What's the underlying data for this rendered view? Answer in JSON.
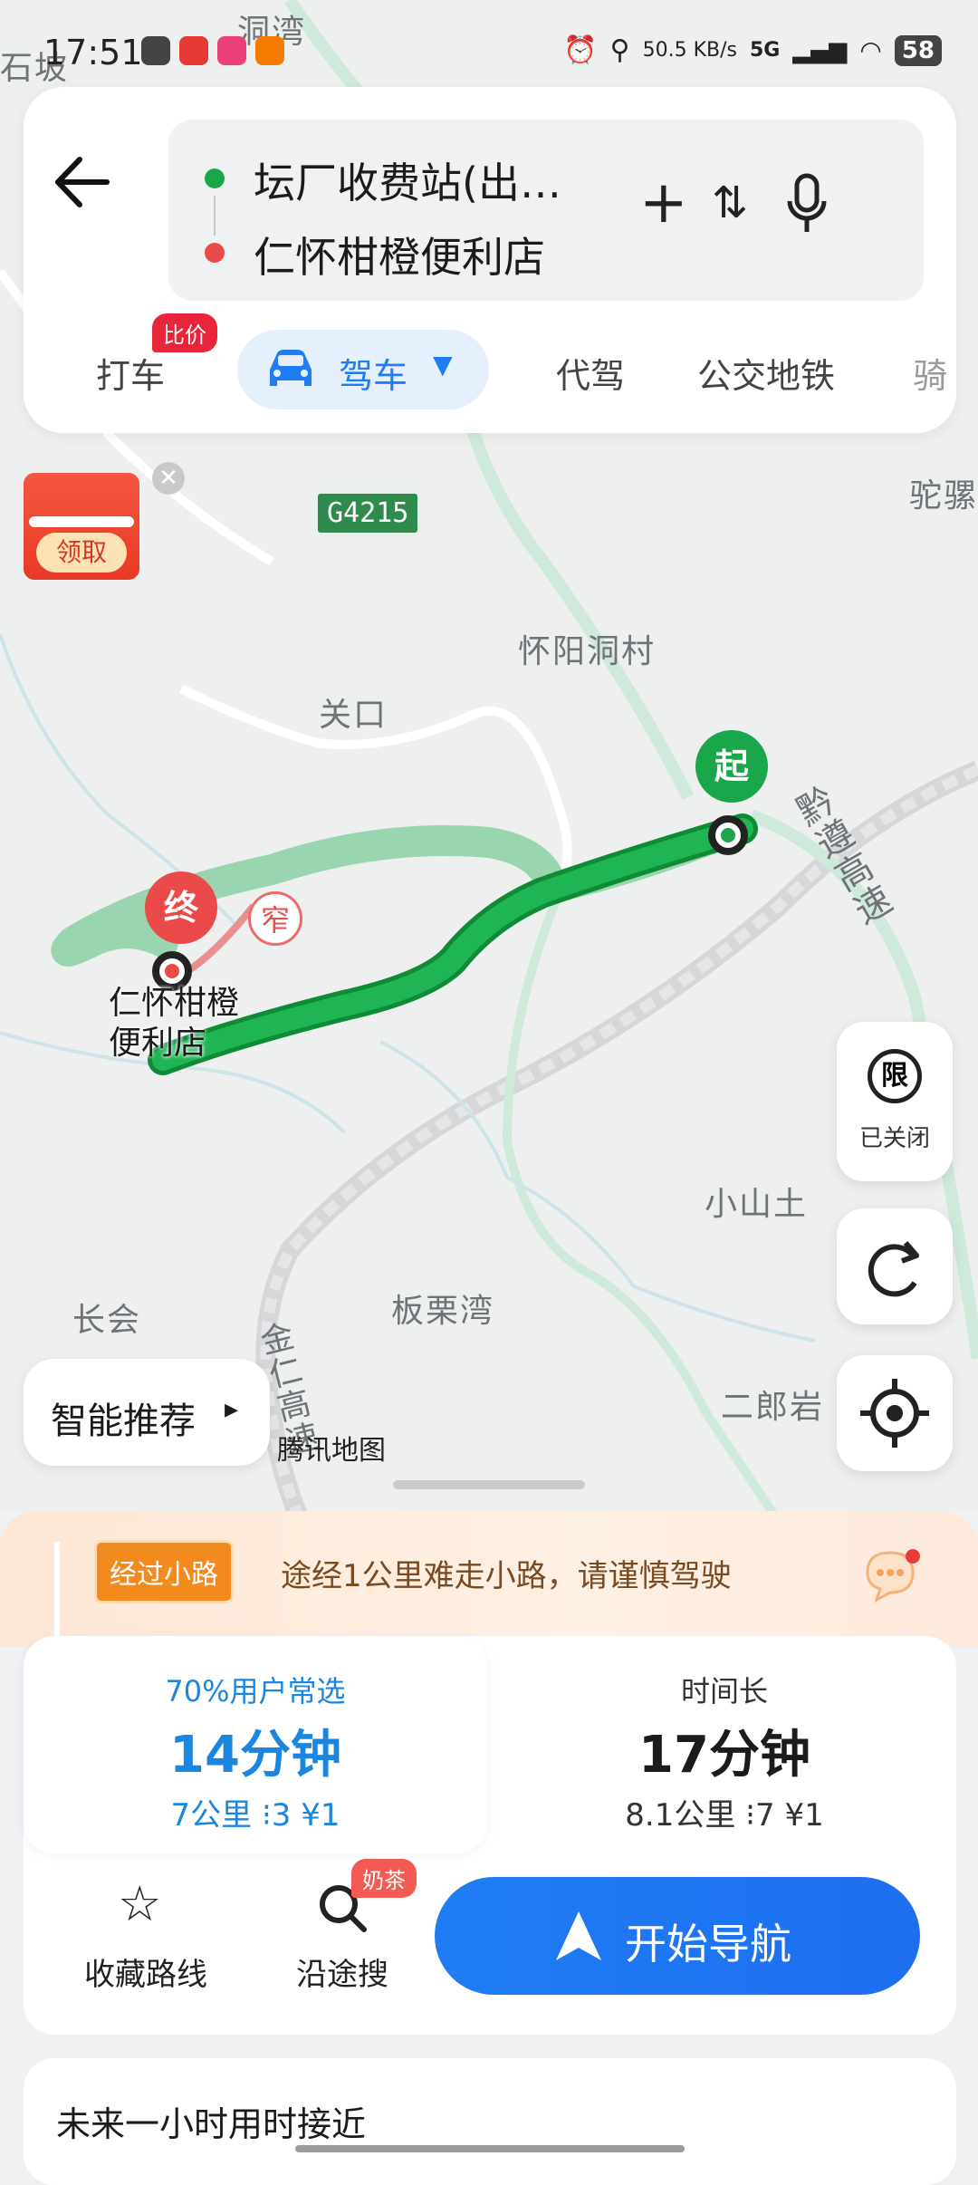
{
  "status": {
    "time": "17:51",
    "speed": "50.5 KB/s",
    "network": "5G",
    "battery": "58"
  },
  "header": {
    "origin": "坛厂收费站(出…",
    "destination": "仁怀柑橙便利店",
    "tabs": {
      "taxi": "打车",
      "taxi_badge": "比价",
      "drive": "驾车",
      "designated": "代驾",
      "transit": "公交地铁",
      "ride": "骑"
    }
  },
  "map": {
    "labels": {
      "dongwan": "洞湾",
      "shipo": "石坡",
      "tuo": "驼骡",
      "g4215": "G4215",
      "huaiyang": "怀阳洞村",
      "guankou": "关口",
      "xiaoshantu": "小山土",
      "changhui": "长会",
      "banliwan": "板栗湾",
      "erlangyan": "二郎岩",
      "jinren": "金仁高速",
      "jinren2": "速",
      "gaosu": "黔遵高速",
      "attribution": "腾讯地图"
    },
    "start_marker": "起",
    "end_marker": "终",
    "narrow_marker": "窄",
    "dest_label": "仁怀柑橙便利店",
    "promo": "领取",
    "limit": {
      "icon_text": "限",
      "label": "已关闭"
    },
    "smart_recommend": "智能推荐"
  },
  "route_notice": {
    "tag": "经过小路",
    "text": "途经1公里难走小路，请谨慎驾驶"
  },
  "routes": [
    {
      "tag": "70%用户常选",
      "time": "14分钟",
      "distance": "7公里",
      "lights": "3",
      "toll": "¥1"
    },
    {
      "tag": "时间长",
      "time": "17分钟",
      "distance": "8.1公里",
      "lights": "7",
      "toll": "¥1"
    }
  ],
  "actions": {
    "favorite": "收藏路线",
    "search": "沿途搜",
    "search_badge": "奶茶",
    "navigate": "开始导航"
  },
  "forecast": "未来一小时用时接近",
  "colors": {
    "accent": "#1f7df4",
    "route": "#1aa64a",
    "start": "#1aa64a",
    "end": "#ea4a4a"
  }
}
